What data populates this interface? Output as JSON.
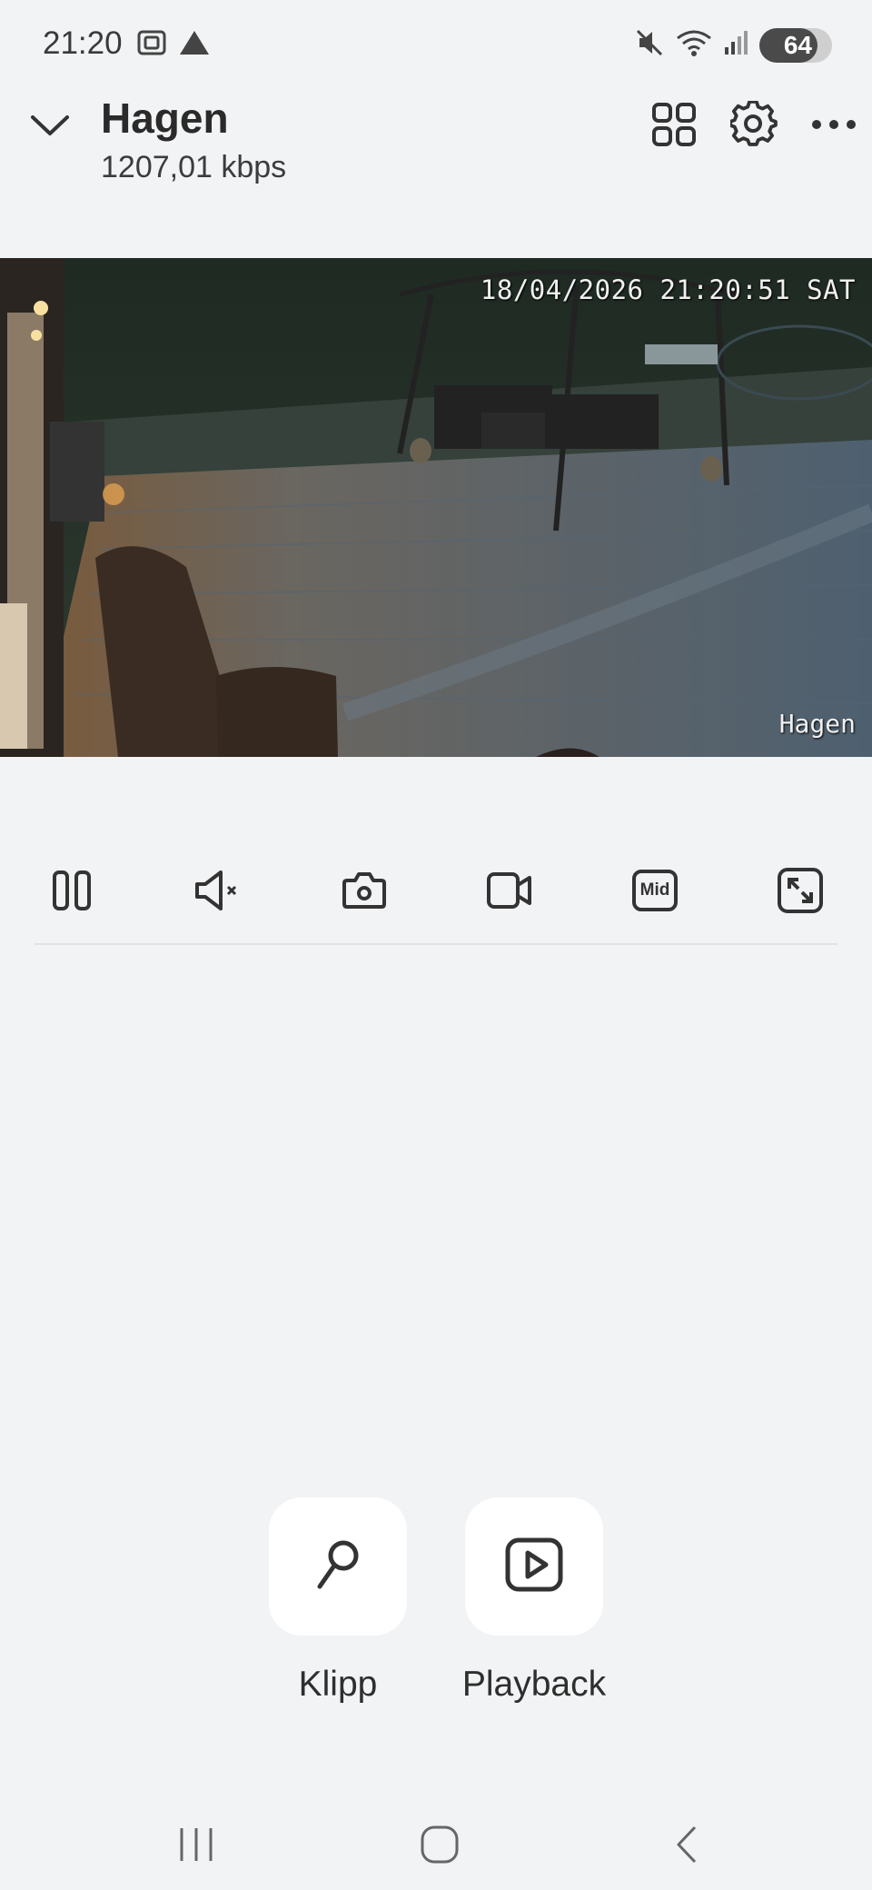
{
  "status_bar": {
    "time": "21:20",
    "battery": "64",
    "icons": [
      "screenshot-icon",
      "alert-triangle-icon",
      "mute-icon",
      "wifi-icon",
      "signal-icon",
      "battery-icon"
    ]
  },
  "header": {
    "title": "Hagen",
    "bitrate": "1207,01 kbps",
    "icons": [
      "chevron-down-icon",
      "grid-icon",
      "gear-icon",
      "more-icon"
    ]
  },
  "video": {
    "timestamp": "18/04/2026 21:20:51 SAT",
    "camera_label": "Hagen"
  },
  "controls": {
    "items": [
      "pause-icon",
      "speaker-muted-icon",
      "snapshot-icon",
      "record-icon",
      "quality-mid",
      "fullscreen-icon"
    ],
    "quality_label": "Mid"
  },
  "actions": {
    "clips_label": "Klipp",
    "playback_label": "Playback"
  },
  "nav": {
    "items": [
      "recents-icon",
      "home-icon",
      "back-icon"
    ]
  },
  "colors": {
    "background": "#f2f3f5",
    "card": "#ffffff",
    "icon": "#333333"
  }
}
